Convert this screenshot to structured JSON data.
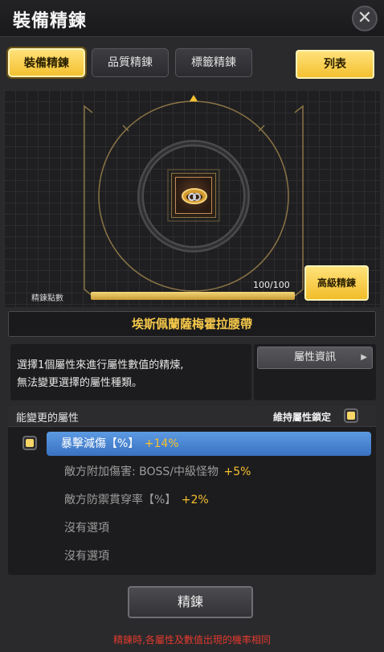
{
  "window": {
    "title": "裝備精鍊",
    "close_glyph": "✕"
  },
  "tabs": [
    {
      "label": "裝備精鍊",
      "active": true
    },
    {
      "label": "品質精鍊",
      "active": false
    },
    {
      "label": "標籤精鍊",
      "active": false
    }
  ],
  "list_button": {
    "label": "列表"
  },
  "stage": {
    "item_icon": "ring-icon",
    "points_label": "精鍊點數",
    "points_value": "100/100",
    "points_fraction": 1.0,
    "advanced_button": "高級精鍊"
  },
  "item_name": "埃斯佩蘭薩梅霍拉腰帶",
  "description": {
    "line1": "選擇1個屬性來進行屬性數值的精煉,",
    "line2": "無法變更選擇的屬性種類。"
  },
  "info_button": {
    "label": "屬性資訊",
    "arrow": "▶"
  },
  "attributes": {
    "header": "能變更的屬性",
    "lock_label": "維持屬性鎖定",
    "rows": [
      {
        "text": "暴擊減傷【%】",
        "bonus": "+14%",
        "selected": true
      },
      {
        "text": "敵方附加傷害: BOSS/中級怪物",
        "bonus": "+5%",
        "selected": false
      },
      {
        "text": "敵方防禦貫穿率【%】",
        "bonus": "+2%",
        "selected": false
      },
      {
        "text": "沒有選項",
        "bonus": "",
        "selected": false
      },
      {
        "text": "沒有選項",
        "bonus": "",
        "selected": false
      }
    ]
  },
  "refine_button": {
    "label": "精鍊"
  },
  "footer_note": "精鍊時,各屬性及數值出現的機率相同",
  "colors": {
    "accent": "#f4c030",
    "selected_row": "#4a86d2",
    "warning": "#e23a2e",
    "item_name": "#f6c84a"
  }
}
